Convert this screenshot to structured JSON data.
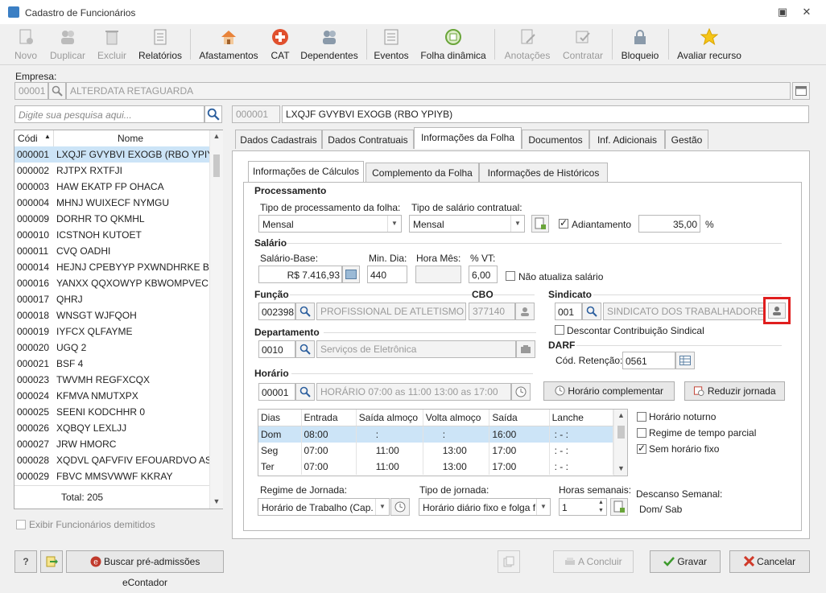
{
  "window": {
    "title": "Cadastro de Funcionários"
  },
  "toolbar": {
    "novo": "Novo",
    "duplicar": "Duplicar",
    "excluir": "Excluir",
    "relatorios": "Relatórios",
    "afastamentos": "Afastamentos",
    "cat": "CAT",
    "dependentes": "Dependentes",
    "eventos": "Eventos",
    "folha_dinamica": "Folha dinâmica",
    "anotacoes": "Anotações",
    "contratar": "Contratar",
    "bloqueio": "Bloqueio",
    "avaliar": "Avaliar recurso"
  },
  "empresa": {
    "label": "Empresa:",
    "code": "00001",
    "name": "ALTERDATA RETAGUARDA"
  },
  "search": {
    "placeholder": "Digite sua pesquisa aqui..."
  },
  "employee": {
    "code": "000001",
    "name": "LXQJF GVYBVI EXOGB (RBO YPIYB)"
  },
  "list": {
    "col_code": "Códi",
    "col_name": "Nome",
    "total": "Total: 205",
    "rows": [
      {
        "code": "000001",
        "name": "LXQJF GVYBVI EXOGB (RBO YPIYB)"
      },
      {
        "code": "000002",
        "name": "RJTPX RXTFJI"
      },
      {
        "code": "000003",
        "name": "HAW EKATP FP OHACA"
      },
      {
        "code": "000004",
        "name": "MHNJ WUIXECF NYMGU"
      },
      {
        "code": "000009",
        "name": "DORHR TO QKMHL"
      },
      {
        "code": "000010",
        "name": "ICSTNOH KUTOET"
      },
      {
        "code": "000011",
        "name": "CVQ OADHI"
      },
      {
        "code": "000014",
        "name": "HEJNJ CPEBYYP PXWNDHRKE BTB J"
      },
      {
        "code": "000016",
        "name": "YANXX QQXOWYP KBWOMPVEC A"
      },
      {
        "code": "000017",
        "name": "QHRJ"
      },
      {
        "code": "000018",
        "name": "WNSGT WJFQOH"
      },
      {
        "code": "000019",
        "name": "IYFCX QLFAYME"
      },
      {
        "code": "000020",
        "name": "UGQ 2"
      },
      {
        "code": "000021",
        "name": "BSF 4"
      },
      {
        "code": "000023",
        "name": "TWVMH REGFXCQX"
      },
      {
        "code": "000024",
        "name": "KFMVA NMUTXPX"
      },
      {
        "code": "000025",
        "name": "SEENI KODCHHR 0"
      },
      {
        "code": "000026",
        "name": "XQBQY LEXLJJ"
      },
      {
        "code": "000027",
        "name": "JRW HMORC"
      },
      {
        "code": "000028",
        "name": "XQDVL QAFVFIV EFOUARDVO AST U"
      },
      {
        "code": "000029",
        "name": "FBVC MMSVWWF KKRAY"
      }
    ],
    "show_dismissed": "Exibir Funcionários demitidos"
  },
  "tabs": [
    "Dados Cadastrais",
    "Dados Contratuais",
    "Informações da Folha",
    "Documentos",
    "Inf. Adicionais",
    "Gestão"
  ],
  "subtabs": [
    "Informações de Cálculos",
    "Complemento da Folha",
    "Informações de Históricos"
  ],
  "processamento": {
    "title": "Processamento",
    "tipo_proc_label": "Tipo de processamento da folha:",
    "tipo_proc_value": "Mensal",
    "tipo_sal_label": "Tipo de salário contratual:",
    "tipo_sal_value": "Mensal",
    "adiantamento_label": "Adiantamento",
    "adiantamento_value": "35,00",
    "percent": "%"
  },
  "salario": {
    "title": "Salário",
    "base_label": "Salário-Base:",
    "base_value": "R$ 7.416,93",
    "min_dia_label": "Min. Dia:",
    "min_dia_value": "440",
    "hora_mes_label": "Hora Mês:",
    "vt_label": "% VT:",
    "vt_value": "6,00",
    "nao_atualiza": "Não atualiza salário"
  },
  "funcao": {
    "title": "Função",
    "code": "002398",
    "name": "PROFISSIONAL DE ATLETISMO",
    "cbo_label": "CBO",
    "cbo_value": "377140"
  },
  "sindicato": {
    "title": "Sindicato",
    "code": "001",
    "name": "SINDICATO DOS TRABALHADORES DE",
    "descontar": "Descontar Contribuição Sindical"
  },
  "departamento": {
    "title": "Departamento",
    "code": "0010",
    "name": "Serviços de Eletrônica"
  },
  "darf": {
    "title": "DARF",
    "label": "Cód. Retenção:",
    "value": "0561"
  },
  "horario": {
    "title": "Horário",
    "code": "00001",
    "desc": "HORÁRIO 07:00 as 11:00  13:00 as 17:00",
    "complementar": "Horário complementar",
    "reduzir": "Reduzir jornada",
    "cols": [
      "Dias",
      "Entrada",
      "Saída almoço",
      "Volta almoço",
      "Saída",
      "Lanche"
    ],
    "rows": [
      [
        "Dom",
        "08:00",
        ":",
        ":",
        "16:00",
        ": - :"
      ],
      [
        "Seg",
        "07:00",
        "11:00",
        "13:00",
        "17:00",
        ": - :"
      ],
      [
        "Ter",
        "07:00",
        "11:00",
        "13:00",
        "17:00",
        ": - :"
      ]
    ],
    "noturno": "Horário noturno",
    "parcial": "Regime de tempo parcial",
    "sem_fixo": "Sem horário fixo"
  },
  "regime": {
    "label": "Regime de Jornada:",
    "value": "Horário de Trabalho (Cap."
  },
  "tipo_jornada": {
    "label": "Tipo de jornada:",
    "value": "Horário diário fixo e folga f"
  },
  "horas_semanais": {
    "label": "Horas semanais:",
    "value": "1"
  },
  "descanso": {
    "label": "Descanso Semanal:",
    "value": "Dom/ Sab"
  },
  "footer": {
    "buscar": "Buscar pré-admissões eContador",
    "concluir": "A Concluir",
    "gravar": "Gravar",
    "cancelar": "Cancelar",
    "help": "?"
  },
  "colors": {
    "highlight": "#e01e1e",
    "selection": "#cce4f7"
  }
}
